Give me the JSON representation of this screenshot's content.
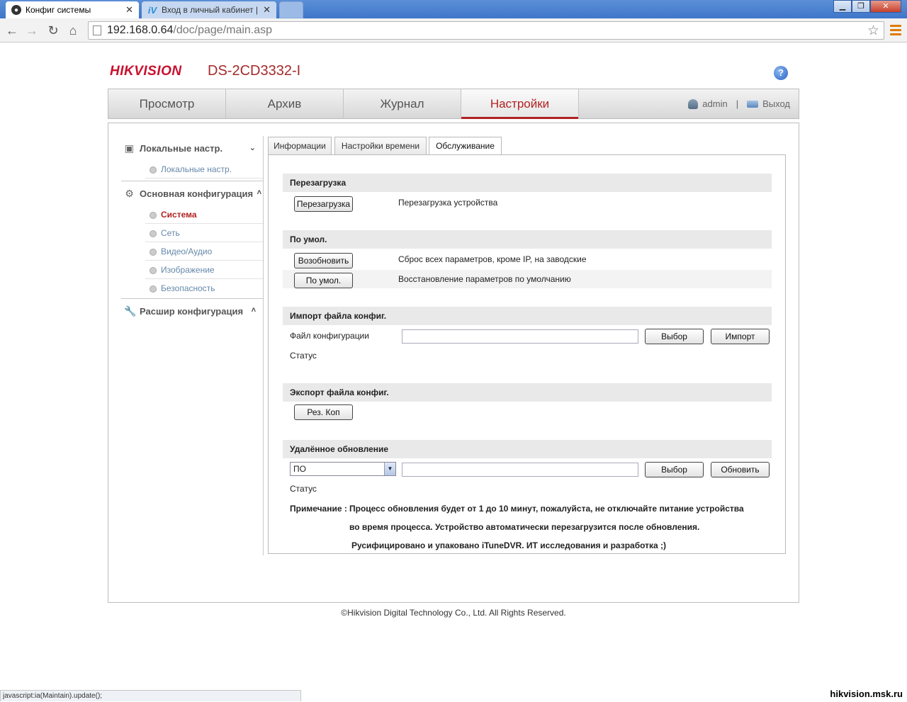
{
  "browser": {
    "tabs": [
      {
        "title": "Конфиг системы",
        "active": true
      },
      {
        "title": "Вход в личный кабинет | Iv",
        "active": false
      }
    ],
    "url_host": "192.168.0.64",
    "url_path": "/doc/page/main.asp",
    "status_text": "javascript:ia(Maintain).update();"
  },
  "header": {
    "brand": "HIKVISION",
    "model": "DS-2CD3332-I"
  },
  "mainnav": {
    "items": [
      "Просмотр",
      "Архив",
      "Журнал",
      "Настройки"
    ],
    "active": "Настройки",
    "user": "admin",
    "separator": "|",
    "logout": "Выход"
  },
  "sidebar": {
    "local": {
      "label": "Локальные настр.",
      "items": [
        "Локальные настр."
      ]
    },
    "basic": {
      "label": "Основная конфигурация",
      "items": [
        "Система",
        "Сеть",
        "Видео/Аудио",
        "Изображение",
        "Безопасность"
      ],
      "active": "Система"
    },
    "advanced": {
      "label": "Расшир конфигурация"
    }
  },
  "subtabs": [
    "Информации",
    "Настройки времени",
    "Обслуживание"
  ],
  "maintenance": {
    "reboot": {
      "title": "Перезагрузка",
      "button": "Перезагрузка",
      "desc": "Перезагрузка устройства"
    },
    "defaults": {
      "title": "По умол.",
      "restore_button": "Возобновить",
      "restore_desc": "Сброс всех параметров, кроме IP, на заводские",
      "default_button": "По умол.",
      "default_desc": "Восстановление параметров по умолчанию"
    },
    "import": {
      "title": "Импорт файла конфиг.",
      "file_label": "Файл конфигурации",
      "file_value": "",
      "browse_button": "Выбор",
      "import_button": "Импорт",
      "status_label": "Статус"
    },
    "export": {
      "title": "Экспорт файла конфиг.",
      "button": "Рез. Коп"
    },
    "upgrade": {
      "title": "Удалённое обновление",
      "select_value": "ПО",
      "file_value": "",
      "browse_button": "Выбор",
      "upgrade_button": "Обновить",
      "status_label": "Статус",
      "note_label": "Примечание :",
      "note_line1": "Процесс обновления будет от 1 до 10 минут, пожалуйста, не отключайте питание устройства",
      "note_line2": "во время процесса. Устройство автоматически перезагрузится после обновления.",
      "note_line3": "Русифицировано и упаковано iTuneDVR. ИТ исследования и разработка ;)"
    }
  },
  "footer": "©Hikvision Digital Technology Co., Ltd. All Rights Reserved.",
  "watermark": "hikvision.msk.ru"
}
